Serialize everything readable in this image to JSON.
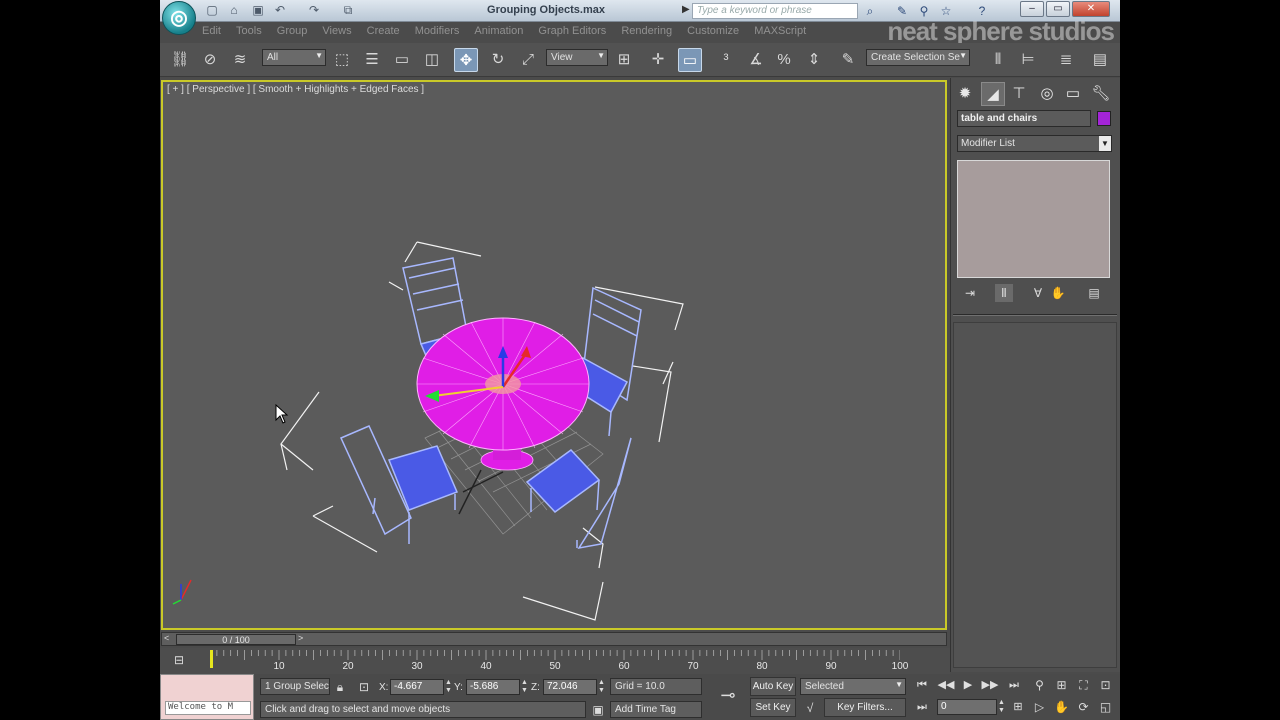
{
  "window": {
    "title": "Grouping Objects.max",
    "search_placeholder": "Type a keyword or phrase",
    "app_logo": "3ds-max-logo",
    "minimize": "–",
    "maximize": "▭",
    "close": "✕"
  },
  "menu": {
    "items": [
      "Edit",
      "Tools",
      "Group",
      "Views",
      "Create",
      "Modifiers",
      "Animation",
      "Graph Editors",
      "Rendering",
      "Customize",
      "MAXScript"
    ],
    "watermark": "neat sphere studios"
  },
  "toolbar": {
    "selection_filter": "All",
    "reference_coord": "View",
    "named_selection": "Create Selection Se"
  },
  "viewport": {
    "label": "[ + ] [ Perspective ] [ Smooth + Highlights + Edged Faces ]",
    "selected_group": "table and chairs",
    "colors": {
      "table": "#e01ee6",
      "chairs": "#4a5ae6",
      "chair_wire": "#a8b8ff",
      "grid": "#9a9a9a",
      "viewport_border": "#c9c928"
    }
  },
  "timeline": {
    "frame_display": "0 / 100",
    "current_frame": 0,
    "total_frames": 100,
    "tick_labels": [
      "10",
      "20",
      "30",
      "40",
      "50",
      "60",
      "70",
      "80",
      "90",
      "100"
    ]
  },
  "status": {
    "maxscript_text": "Welcome to M",
    "selection_count": "1 Group Selec",
    "x_label": "X:",
    "x_value": "-4.667",
    "y_label": "Y:",
    "y_value": "-5.686",
    "z_label": "Z:",
    "z_value": "72.046",
    "grid": "Grid = 10.0",
    "prompt": "Click and drag to select and move objects",
    "add_time_tag": "Add Time Tag",
    "auto_key": "Auto Key",
    "set_key": "Set Key",
    "key_filters": "Key Filters...",
    "selected_dd": "Selected",
    "frame_field": "0"
  },
  "command_panel": {
    "object_name": "table and chairs",
    "object_color": "#a424d8",
    "modifier_list": "Modifier List"
  }
}
